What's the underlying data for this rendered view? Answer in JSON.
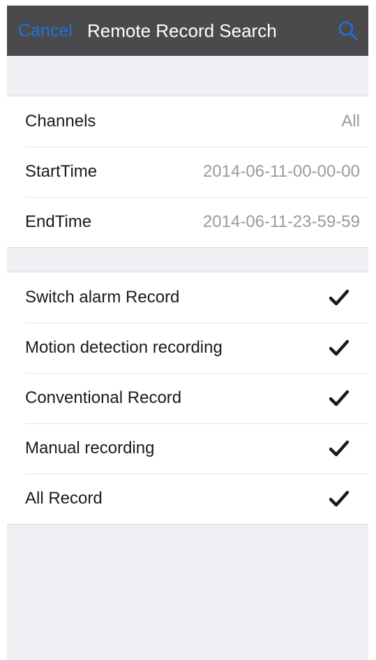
{
  "navbar": {
    "cancel_label": "Cancel",
    "title": "Remote Record Search",
    "search_icon": "search-icon",
    "background": "#4a4a4c",
    "accent": "#1c74d9"
  },
  "search_settings": {
    "rows": [
      {
        "label": "Channels",
        "value": "All"
      },
      {
        "label": "StartTime",
        "value": "2014-06-11-00-00-00"
      },
      {
        "label": "EndTime",
        "value": "2014-06-11-23-59-59"
      }
    ]
  },
  "record_types": {
    "check_icon": "checkmark-icon",
    "rows": [
      {
        "label": "Switch alarm Record",
        "checked": true
      },
      {
        "label": "Motion detection recording",
        "checked": true
      },
      {
        "label": "Conventional Record",
        "checked": true
      },
      {
        "label": "Manual recording",
        "checked": true
      },
      {
        "label": "All Record",
        "checked": true
      }
    ]
  }
}
